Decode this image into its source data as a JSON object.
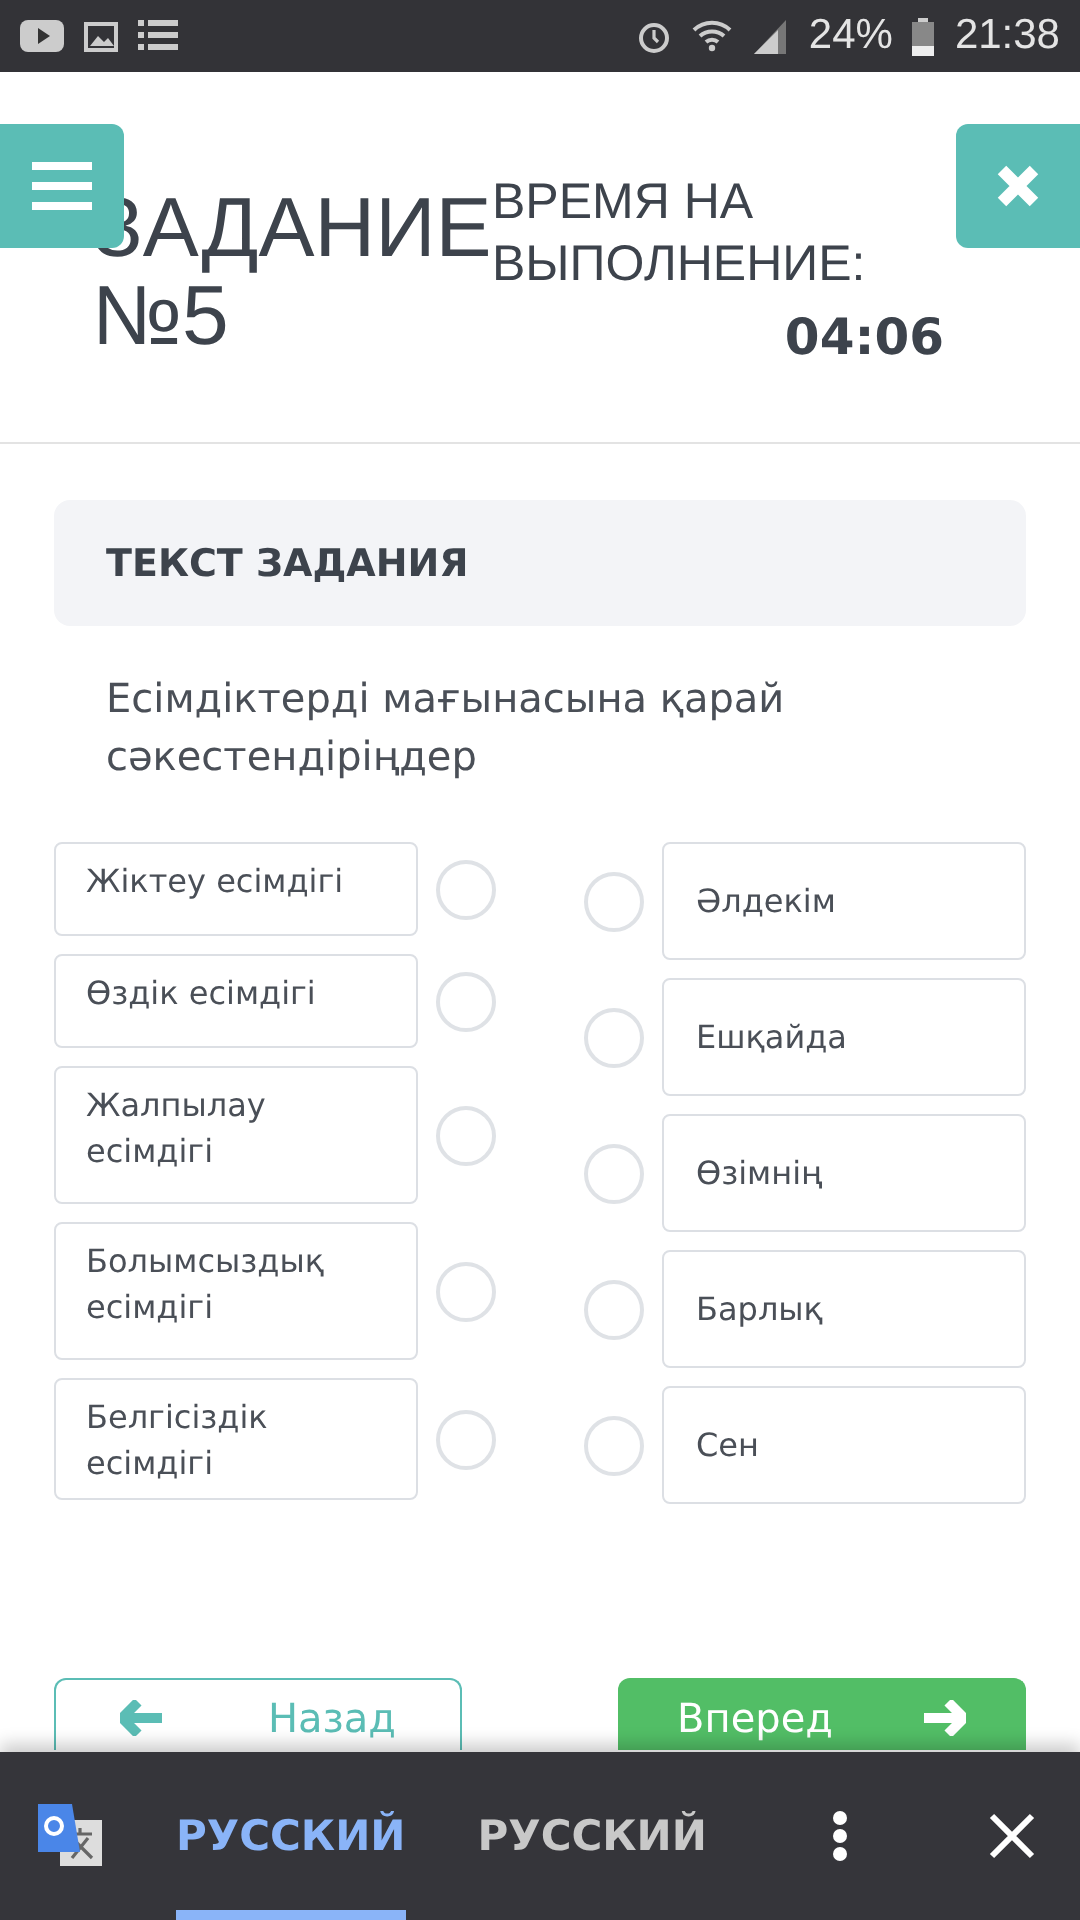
{
  "status_bar": {
    "battery": "24%",
    "time": "21:38"
  },
  "header": {
    "title": "ЗАДАНИЕ №5",
    "time_label": "ВРЕМЯ НА ВЫПОЛНЕНИЕ:",
    "time_left": "04:06"
  },
  "task": {
    "heading": "ТЕКСТ ЗАДАНИЯ",
    "question": "Есімдіктерді мағынасына қарай сәкестендіріңдер"
  },
  "left_items": [
    {
      "label": "Жіктеу есімдігі",
      "checked": false
    },
    {
      "label": "Өздік есімдігі",
      "checked": false
    },
    {
      "label": "Жалпылау есімдігі",
      "checked": false
    },
    {
      "label": "Болымсыздық есімдігі",
      "checked": false
    },
    {
      "label": "Белгісіздік есімдігі",
      "checked": false
    }
  ],
  "right_items": [
    {
      "label": "Әлдекім",
      "checked": false
    },
    {
      "label": "Ешқайда",
      "checked": false
    },
    {
      "label": "Өзімнің",
      "checked": false
    },
    {
      "label": "Барлық",
      "checked": false
    },
    {
      "label": "Сен",
      "checked": false
    }
  ],
  "nav": {
    "back": "Назад",
    "next": "Вперед"
  },
  "translate_bar": {
    "languages": [
      {
        "label": "РУССКИЙ",
        "selected": true
      },
      {
        "label": "РУССКИЙ",
        "selected": false
      }
    ]
  }
}
